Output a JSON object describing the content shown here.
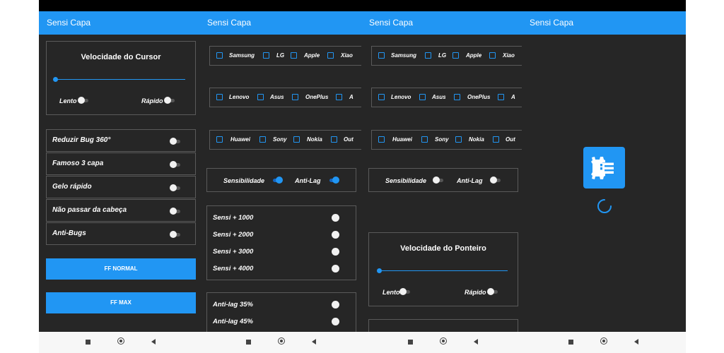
{
  "app": {
    "title": "Sensi Capa"
  },
  "colors": {
    "accent": "#2196f3",
    "background": "#262626",
    "border": "#5a5a5a"
  },
  "icons": {
    "nav_recents": "square-icon",
    "nav_home": "circle-icon",
    "nav_back": "back-triangle-icon",
    "app_logo": "gear-settings-icon",
    "spinner": "loading-spinner-icon"
  },
  "screen1": {
    "cursor_slider": {
      "title": "Velocidade do Cursor",
      "min_label": "Lento",
      "max_label": "Rápido",
      "value": 0
    },
    "options": [
      {
        "label": "Reduzir Bug 360°",
        "on": false
      },
      {
        "label": "Famoso 3 capa",
        "on": false
      },
      {
        "label": "Gelo rápido",
        "on": false
      },
      {
        "label": "Não passar da cabeça",
        "on": false
      },
      {
        "label": "Anti-Bugs",
        "on": false
      }
    ],
    "btn_normal": "FF NORMAL",
    "btn_max": "FF MAX"
  },
  "screen2": {
    "brands_row1": [
      "Samsung",
      "LG",
      "Apple",
      "Xiao"
    ],
    "brands_row2": [
      "Lenovo",
      "Asus",
      "OnePlus",
      "A"
    ],
    "brands_row3": [
      "Huawei",
      "Sony",
      "Nokia",
      "Out"
    ],
    "sens_label": "Sensibilidade",
    "sens_on": true,
    "antilag_label": "Anti-Lag",
    "antilag_on": true,
    "sensi": [
      "Sensi + 1000",
      "Sensi + 2000",
      "Sensi + 3000",
      "Sensi + 4000"
    ],
    "antilag": [
      "Anti-lag 35%",
      "Anti-lag 45%"
    ]
  },
  "screen3": {
    "brands_row1": [
      "Samsung",
      "LG",
      "Apple",
      "Xiao"
    ],
    "brands_row2": [
      "Lenovo",
      "Asus",
      "OnePlus",
      "A"
    ],
    "brands_row3": [
      "Huawei",
      "Sony",
      "Nokia",
      "Out"
    ],
    "sens_label": "Sensibilidade",
    "sens_on": false,
    "antilag_label": "Anti-Lag",
    "antilag_on": false,
    "pointer_slider": {
      "title": "Velocidade do Ponteiro",
      "min_label": "Lento",
      "max_label": "Rápido",
      "value": 0
    }
  }
}
